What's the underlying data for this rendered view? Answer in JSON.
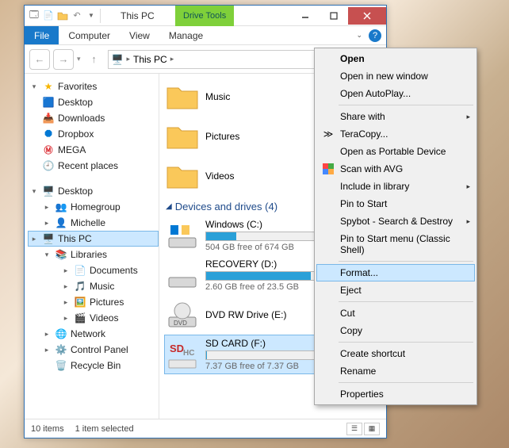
{
  "titlebar": {
    "title": "This PC",
    "drive_tools": "Drive Tools"
  },
  "ribbon": {
    "file": "File",
    "computer": "Computer",
    "view": "View",
    "manage": "Manage"
  },
  "address": {
    "root": "This PC"
  },
  "search": {
    "placeholder": ""
  },
  "tree": {
    "favorites": "Favorites",
    "fav_items": [
      {
        "label": "Desktop"
      },
      {
        "label": "Downloads"
      },
      {
        "label": "Dropbox"
      },
      {
        "label": "MEGA"
      },
      {
        "label": "Recent places"
      }
    ],
    "desktop": "Desktop",
    "desk_items": [
      {
        "label": "Homegroup"
      },
      {
        "label": "Michelle"
      },
      {
        "label": "This PC"
      },
      {
        "label": "Libraries"
      },
      {
        "label": "Documents",
        "sub": true
      },
      {
        "label": "Music",
        "sub": true
      },
      {
        "label": "Pictures",
        "sub": true
      },
      {
        "label": "Videos",
        "sub": true
      },
      {
        "label": "Network"
      },
      {
        "label": "Control Panel"
      },
      {
        "label": "Recycle Bin"
      }
    ]
  },
  "main": {
    "folders": [
      {
        "label": "Music"
      },
      {
        "label": "Pictures"
      },
      {
        "label": "Videos"
      }
    ],
    "devices_header": "Devices and drives (4)",
    "devices": [
      {
        "label": "Windows (C:)",
        "sub": "504 GB free of 674 GB",
        "fill": 26
      },
      {
        "label": "RECOVERY (D:)",
        "sub": "2.60 GB free of 23.5 GB",
        "fill": 89
      },
      {
        "label": "DVD RW Drive (E:)",
        "sub": "",
        "fill": null
      },
      {
        "label": "SD CARD (F:)",
        "sub": "7.37 GB free of 7.37 GB",
        "fill": 1
      }
    ]
  },
  "status": {
    "items": "10 items",
    "selected": "1 item selected"
  },
  "ctx": {
    "open": "Open",
    "open_new": "Open in new window",
    "autoplay": "Open AutoPlay...",
    "share": "Share with",
    "teracopy": "TeraCopy...",
    "portable": "Open as Portable Device",
    "avg": "Scan with AVG",
    "library": "Include in library",
    "pin_start": "Pin to Start",
    "spybot": "Spybot - Search & Destroy",
    "pin_classic": "Pin to Start menu (Classic Shell)",
    "format": "Format...",
    "eject": "Eject",
    "cut": "Cut",
    "copy": "Copy",
    "shortcut": "Create shortcut",
    "rename": "Rename",
    "properties": "Properties"
  }
}
